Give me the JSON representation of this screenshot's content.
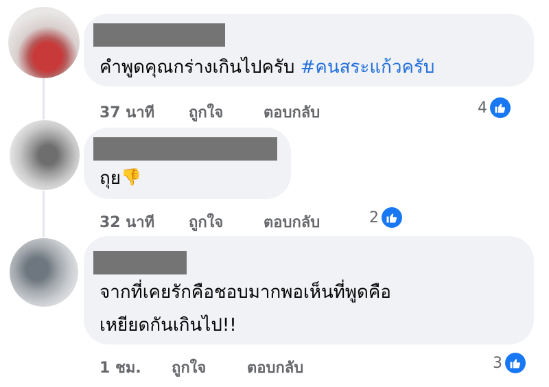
{
  "comments": [
    {
      "text_plain": "คำพูดคุณกร่างเกินไปครับ ",
      "hashtag": "#คนสระแก้วครับ",
      "time": "37 นาที",
      "like_label": "ถูกใจ",
      "reply_label": "ตอบกลับ",
      "reaction_count": "4"
    },
    {
      "text_plain": "ถุย",
      "emoji": "👎",
      "time": "32 นาที",
      "like_label": "ถูกใจ",
      "reply_label": "ตอบกลับ",
      "reaction_count": "2"
    },
    {
      "text_line1": "จากที่เคยรักคือชอบมากพอเห็นที่พูดคือ",
      "text_line2": "เหยียดกันเกินไป!!",
      "time": "1 ชม.",
      "like_label": "ถูกใจ",
      "reply_label": "ตอบกลับ",
      "reaction_count": "3"
    }
  ],
  "colors": {
    "bubble": "#f0f2f5",
    "hashtag": "#216fdb",
    "meta": "#65676b",
    "like": "#1877f2",
    "redaction": "#747474"
  },
  "icons": {
    "reaction": "thumbs-up-icon"
  }
}
